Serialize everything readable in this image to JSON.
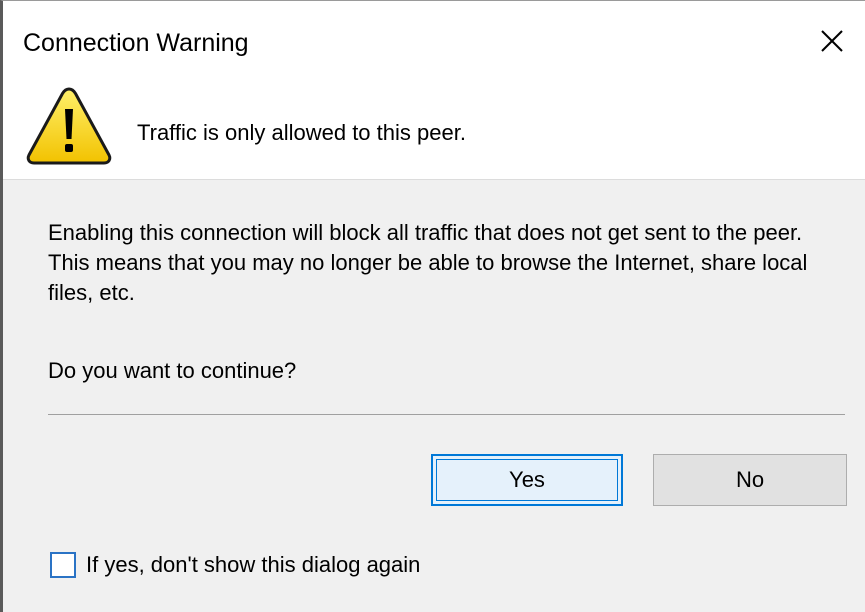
{
  "window": {
    "title": "Connection Warning",
    "close_icon": "close-x-icon"
  },
  "header": {
    "icon": "warning-triangle-icon",
    "icon_colors": {
      "fill": "#f5d400",
      "outline": "#1a1a1a",
      "mark": "#000000"
    },
    "message": "Traffic is only allowed to this peer."
  },
  "body": {
    "text": "Enabling this connection will block all traffic that does not get sent to the peer. This means that you may no longer be able to browse the Internet, share local files, etc.",
    "question": "Do you want to continue?"
  },
  "buttons": {
    "yes_label": "Yes",
    "no_label": "No"
  },
  "checkbox": {
    "label": "If yes, don't show this dialog again",
    "checked": false
  },
  "colors": {
    "accent": "#0078d7",
    "panel_background": "#f0f0f0",
    "button_background": "#e1e1e1"
  }
}
